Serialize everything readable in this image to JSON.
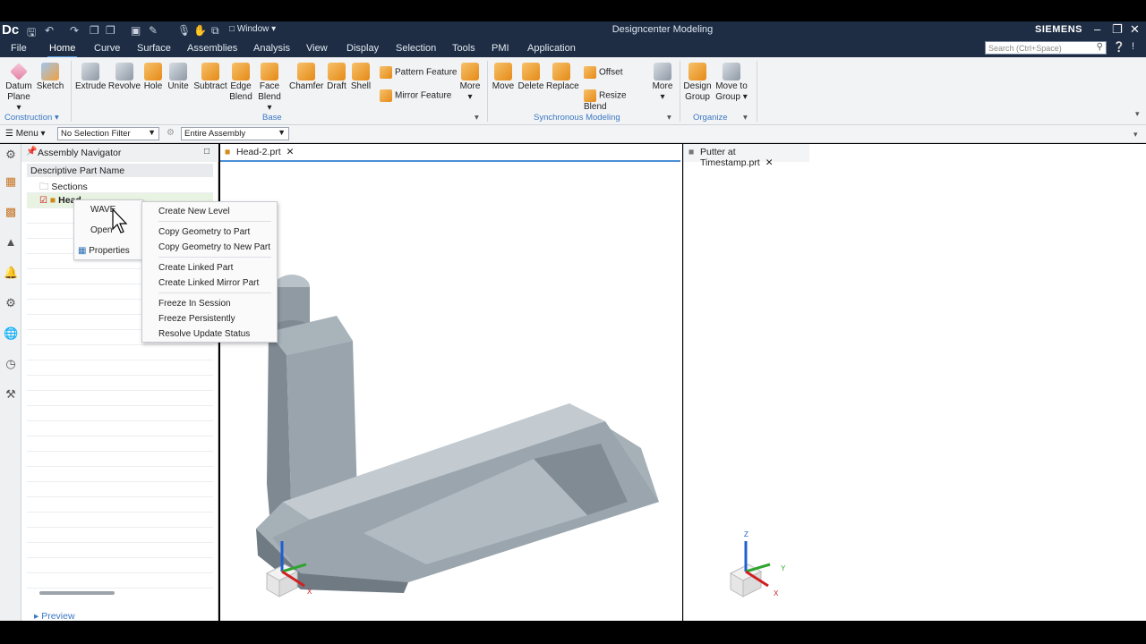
{
  "titlebar": {
    "logo": "Dc",
    "window_menu": "Window",
    "title": "Designcenter Modeling",
    "brand": "SIEMENS"
  },
  "menubar": {
    "tabs": [
      "File",
      "Home",
      "Curve",
      "Surface",
      "Assemblies",
      "Analysis",
      "View",
      "Display",
      "Selection",
      "Tools",
      "PMI",
      "Application"
    ],
    "search_placeholder": "Search (Ctrl+Space)"
  },
  "ribbon": {
    "datum_plane": "Datum Plane",
    "sketch": "Sketch",
    "extrude": "Extrude",
    "revolve": "Revolve",
    "hole": "Hole",
    "unite": "Unite",
    "subtract": "Subtract",
    "edge_blend": "Edge Blend",
    "face_blend": "Face Blend",
    "chamfer": "Chamfer",
    "draft": "Draft",
    "shell": "Shell",
    "pattern_feature": "Pattern Feature",
    "mirror_feature": "Mirror Feature",
    "more1": "More",
    "move": "Move",
    "delete": "Delete",
    "replace": "Replace",
    "offset": "Offset",
    "resize_blend": "Resize Blend",
    "more2": "More",
    "design_group": "Design Group",
    "move_to_group": "Move to Group",
    "groups": [
      "Construction",
      "Base",
      "Synchronous Modeling",
      "Organize"
    ]
  },
  "selbar": {
    "menu": "Menu",
    "filter": "No Selection Filter",
    "scope": "Entire Assembly"
  },
  "navigator": {
    "title": "Assembly Navigator",
    "column": "Descriptive Part Name",
    "rows": [
      "Sections",
      "Head"
    ],
    "preview": "Preview"
  },
  "context_menu": {
    "items": [
      "WAVE",
      "Open",
      "Properties"
    ]
  },
  "wave_submenu": {
    "items": [
      "Create New Level",
      "Copy Geometry to Part",
      "Copy Geometry to New Part",
      "Create Linked Part",
      "Create Linked Mirror Part",
      "Freeze In Session",
      "Freeze Persistently",
      "Resolve Update Status"
    ]
  },
  "tabs": {
    "left": "Head-2.prt",
    "right": "Putter at Timestamp.prt"
  },
  "triad": {
    "x": "X",
    "y": "Y",
    "z": "Z"
  }
}
